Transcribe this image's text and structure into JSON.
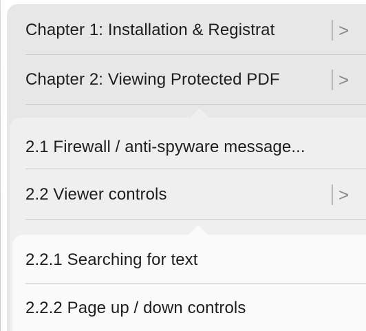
{
  "menu_level_1": {
    "items": [
      {
        "label": "Chapter 1:  Installation & Registrat",
        "has_submenu": true
      },
      {
        "label": "Chapter 2: Viewing Protected PDF",
        "has_submenu": true
      }
    ]
  },
  "menu_level_2": {
    "items": [
      {
        "label": "2.1 Firewall / anti-spyware message...",
        "has_submenu": false
      },
      {
        "label": "2.2 Viewer controls",
        "has_submenu": true
      }
    ]
  },
  "menu_level_3": {
    "items": [
      {
        "label": "2.2.1 Searching for text",
        "has_submenu": false
      },
      {
        "label": "2.2.2 Page up / down controls",
        "has_submenu": false
      }
    ]
  },
  "icons": {
    "chevron": ">"
  }
}
